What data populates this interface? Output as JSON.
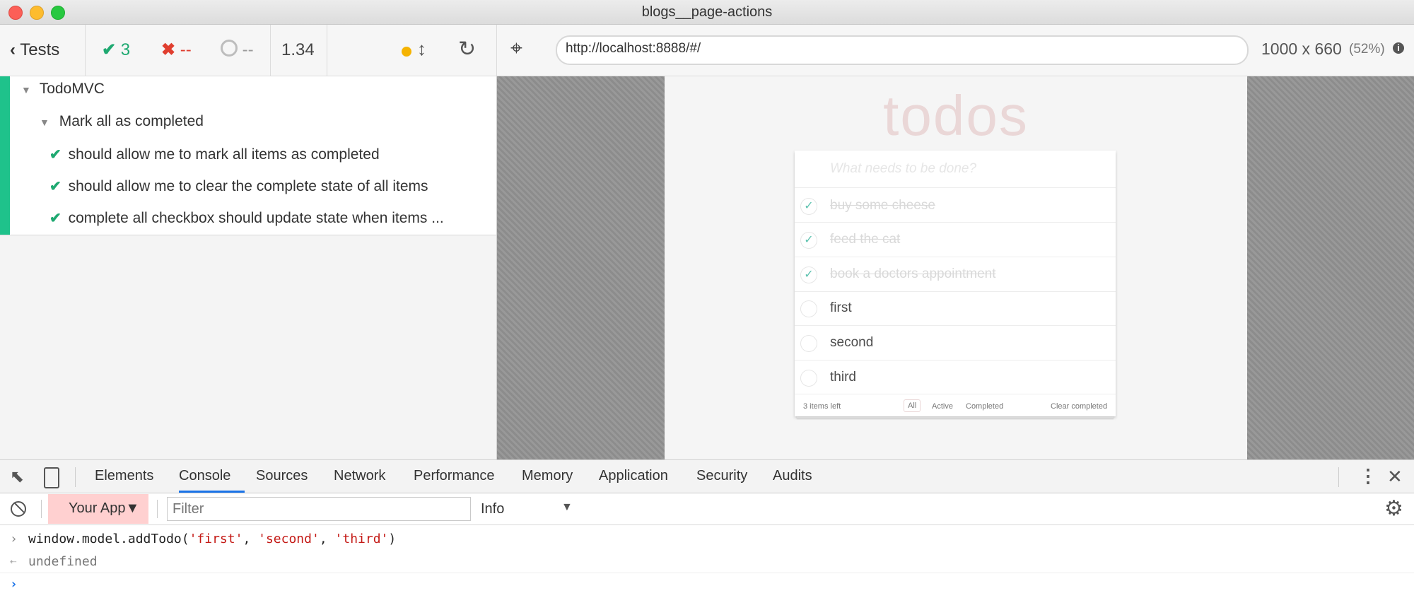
{
  "window": {
    "title": "blogs__page-actions"
  },
  "toolbar": {
    "tests_label": "Tests",
    "passed": "3",
    "failed": "--",
    "pending": "--",
    "duration": "1.34",
    "url": "http://localhost:8888/#/",
    "viewport_size": "1000 x 660",
    "viewport_scale": "(52%)",
    "info": "i"
  },
  "reporter": {
    "suite": "TodoMVC",
    "sub_suite": "Mark all as completed",
    "tests": [
      {
        "title": "should allow me to mark all items as completed"
      },
      {
        "title": "should allow me to clear the complete state of all items"
      },
      {
        "title": "complete all checkbox should update state when items ..."
      }
    ]
  },
  "aut": {
    "app_title": "todos",
    "new_todo_placeholder": "What needs to be done?",
    "items": [
      {
        "label": "buy some cheese",
        "completed": true
      },
      {
        "label": "feed the cat",
        "completed": true
      },
      {
        "label": "book a doctors appointment",
        "completed": true
      },
      {
        "label": "first",
        "completed": false
      },
      {
        "label": "second",
        "completed": false
      },
      {
        "label": "third",
        "completed": false
      }
    ],
    "footer": {
      "items_left": "3 items left",
      "filter_all": "All",
      "filter_active": "Active",
      "filter_completed": "Completed",
      "clear_completed": "Clear completed"
    }
  },
  "devtools": {
    "tabs": [
      "Elements",
      "Console",
      "Sources",
      "Network",
      "Performance",
      "Memory",
      "Application",
      "Security",
      "Audits"
    ],
    "active_tab": "Console",
    "context": "Your App",
    "filter_placeholder": "Filter",
    "level": "Info",
    "console": {
      "input_prefix": "window.model.addTodo(",
      "arg1": "'first'",
      "arg2": "'second'",
      "arg3": "'third'",
      "comma": ", ",
      "close": ")",
      "result": "undefined"
    }
  }
}
